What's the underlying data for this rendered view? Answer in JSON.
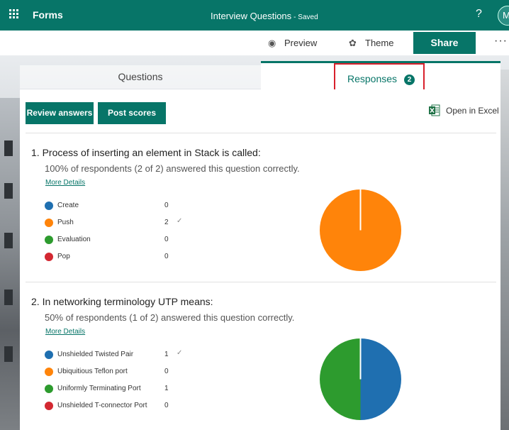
{
  "header": {
    "app_name": "Forms",
    "form_title": "Interview Questions",
    "save_status": "- Saved",
    "help_label": "?",
    "avatar_initial": "M"
  },
  "commands": {
    "preview": "Preview",
    "theme": "Theme",
    "share": "Share",
    "more": "···"
  },
  "tabs": {
    "questions": "Questions",
    "responses": "Responses",
    "responses_count": "2"
  },
  "toolbar": {
    "review_answers": "Review answers",
    "post_scores": "Post scores",
    "open_in_excel": "Open in Excel"
  },
  "colors": {
    "brand": "#077568",
    "highlight": "#d8202c",
    "blue": "#1f6fb0",
    "orange": "#ff840a",
    "green": "#2d9b2e",
    "red": "#d32831"
  },
  "questions": [
    {
      "title": "1.  Process of inserting an element in Stack is called:",
      "summary": "100% of respondents (2 of 2) answered this question correctly.",
      "more_details": "More Details",
      "options": [
        {
          "label": "Create",
          "count": "0",
          "correct": false
        },
        {
          "label": "Push",
          "count": "2",
          "correct": true
        },
        {
          "label": "Evaluation",
          "count": "0",
          "correct": false
        },
        {
          "label": "Pop",
          "count": "0",
          "correct": false
        }
      ]
    },
    {
      "title": "2.  In networking terminology UTP means:",
      "summary": "50% of respondents (1 of 2) answered this question correctly.",
      "more_details": "More Details",
      "options": [
        {
          "label": "Unshielded Twisted Pair",
          "count": "1",
          "correct": true
        },
        {
          "label": "Ubiquitious Teflon port",
          "count": "0",
          "correct": false
        },
        {
          "label": "Uniformly Terminating Port",
          "count": "1",
          "correct": false
        },
        {
          "label": "Unshielded T-connector Port",
          "count": "0",
          "correct": false
        }
      ]
    }
  ],
  "chart_data": [
    {
      "type": "pie",
      "categories": [
        "Create",
        "Push",
        "Evaluation",
        "Pop"
      ],
      "values": [
        0,
        2,
        0,
        0
      ],
      "colors": [
        "#1f6fb0",
        "#ff840a",
        "#2d9b2e",
        "#d32831"
      ]
    },
    {
      "type": "pie",
      "categories": [
        "Unshielded Twisted Pair",
        "Ubiquitious Teflon port",
        "Uniformly Terminating Port",
        "Unshielded T-connector Port"
      ],
      "values": [
        1,
        0,
        1,
        0
      ],
      "colors": [
        "#1f6fb0",
        "#ff840a",
        "#2d9b2e",
        "#d32831"
      ]
    }
  ]
}
